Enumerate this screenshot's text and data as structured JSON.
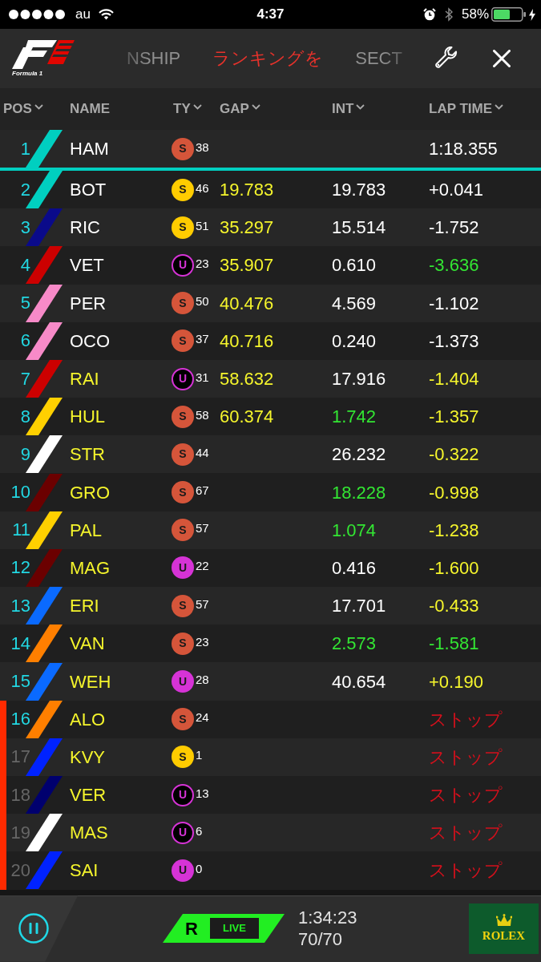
{
  "status_bar": {
    "carrier": "au",
    "time": "4:37",
    "battery": "58%"
  },
  "header": {
    "logo_caption": "Formula 1",
    "tabs": [
      {
        "label": "NSHIP",
        "selected": false
      },
      {
        "label": "ランキングを",
        "selected": true
      },
      {
        "label": "SECT",
        "selected": false
      }
    ]
  },
  "columns": [
    {
      "label": "POS",
      "sortable": true
    },
    {
      "label": "NAME",
      "sortable": false
    },
    {
      "label": "TY",
      "sortable": true
    },
    {
      "label": "GAP",
      "sortable": true
    },
    {
      "label": "INT",
      "sortable": true
    },
    {
      "label": "LAP TIME",
      "sortable": true
    }
  ],
  "rows": [
    {
      "pos": {
        "text": "1",
        "color": "#22d7e2"
      },
      "stripe": {
        "color": "#00cfc0"
      },
      "name": {
        "text": "HAM",
        "color": "#ffffff"
      },
      "tyre": {
        "compound": "S",
        "color": "#d5553a",
        "outline": false,
        "laps": "38"
      },
      "lap_time": {
        "text": "1:18.355",
        "color": "#ffffff"
      },
      "retired": false
    },
    {
      "pos": {
        "text": "2",
        "color": "#22d7e2"
      },
      "stripe": {
        "color": "#00cfc0"
      },
      "name": {
        "text": "BOT",
        "color": "#ffffff"
      },
      "tyre": {
        "compound": "S",
        "color": "#ffcc00",
        "outline": false,
        "laps": "46"
      },
      "gap": {
        "text": "19.783",
        "color": "#f5f52c"
      },
      "interval": {
        "text": "19.783",
        "color": "#ffffff"
      },
      "lap_time": {
        "text": "+0.041",
        "color": "#ffffff"
      },
      "retired": false
    },
    {
      "pos": {
        "text": "3",
        "color": "#22d7e2"
      },
      "stripe": {
        "color": "#0a0a8a"
      },
      "name": {
        "text": "RIC",
        "color": "#ffffff"
      },
      "tyre": {
        "compound": "S",
        "color": "#ffcc00",
        "outline": false,
        "laps": "51"
      },
      "gap": {
        "text": "35.297",
        "color": "#f5f52c"
      },
      "interval": {
        "text": "15.514",
        "color": "#ffffff"
      },
      "lap_time": {
        "text": "-1.752",
        "color": "#ffffff"
      },
      "retired": false
    },
    {
      "pos": {
        "text": "4",
        "color": "#22d7e2"
      },
      "stripe": {
        "color": "#cc0000"
      },
      "name": {
        "text": "VET",
        "color": "#ffffff"
      },
      "tyre": {
        "compound": "U",
        "color": "#d633d6",
        "outline": true,
        "laps": "23"
      },
      "gap": {
        "text": "35.907",
        "color": "#f5f52c"
      },
      "interval": {
        "text": "0.610",
        "color": "#ffffff"
      },
      "lap_time": {
        "text": "-3.636",
        "color": "#33e633"
      },
      "retired": false
    },
    {
      "pos": {
        "text": "5",
        "color": "#22d7e2"
      },
      "stripe": {
        "color": "#f78ac8"
      },
      "name": {
        "text": "PER",
        "color": "#ffffff"
      },
      "tyre": {
        "compound": "S",
        "color": "#d5553a",
        "outline": false,
        "laps": "50"
      },
      "gap": {
        "text": "40.476",
        "color": "#f5f52c"
      },
      "interval": {
        "text": "4.569",
        "color": "#ffffff"
      },
      "lap_time": {
        "text": "-1.102",
        "color": "#ffffff"
      },
      "retired": false
    },
    {
      "pos": {
        "text": "6",
        "color": "#22d7e2"
      },
      "stripe": {
        "color": "#f78ac8"
      },
      "name": {
        "text": "OCO",
        "color": "#ffffff"
      },
      "tyre": {
        "compound": "S",
        "color": "#d5553a",
        "outline": false,
        "laps": "37"
      },
      "gap": {
        "text": "40.716",
        "color": "#f5f52c"
      },
      "interval": {
        "text": "0.240",
        "color": "#ffffff"
      },
      "lap_time": {
        "text": "-1.373",
        "color": "#ffffff"
      },
      "retired": false
    },
    {
      "pos": {
        "text": "7",
        "color": "#22d7e2"
      },
      "stripe": {
        "color": "#cc0000"
      },
      "name": {
        "text": "RAI",
        "color": "#f5f52c"
      },
      "tyre": {
        "compound": "U",
        "color": "#d633d6",
        "outline": true,
        "laps": "31"
      },
      "gap": {
        "text": "58.632",
        "color": "#f5f52c"
      },
      "interval": {
        "text": "17.916",
        "color": "#ffffff"
      },
      "lap_time": {
        "text": "-1.404",
        "color": "#f5f52c"
      },
      "retired": false
    },
    {
      "pos": {
        "text": "8",
        "color": "#22d7e2"
      },
      "stripe": {
        "color": "#ffd000"
      },
      "name": {
        "text": "HUL",
        "color": "#f5f52c"
      },
      "tyre": {
        "compound": "S",
        "color": "#d5553a",
        "outline": false,
        "laps": "58"
      },
      "gap": {
        "text": "60.374",
        "color": "#f5f52c"
      },
      "interval": {
        "text": "1.742",
        "color": "#33e633"
      },
      "lap_time": {
        "text": "-1.357",
        "color": "#f5f52c"
      },
      "retired": false
    },
    {
      "pos": {
        "text": "9",
        "color": "#22d7e2"
      },
      "stripe": {
        "color": "#ffffff"
      },
      "name": {
        "text": "STR",
        "color": "#f5f52c"
      },
      "tyre": {
        "compound": "S",
        "color": "#d5553a",
        "outline": false,
        "laps": "44"
      },
      "interval": {
        "text": "26.232",
        "color": "#ffffff"
      },
      "lap_time": {
        "text": "-0.322",
        "color": "#f5f52c"
      },
      "retired": false
    },
    {
      "pos": {
        "text": "10",
        "color": "#22d7e2"
      },
      "stripe": {
        "color": "#6b0000"
      },
      "name": {
        "text": "GRO",
        "color": "#f5f52c"
      },
      "tyre": {
        "compound": "S",
        "color": "#d5553a",
        "outline": false,
        "laps": "67"
      },
      "interval": {
        "text": "18.228",
        "color": "#33e633"
      },
      "lap_time": {
        "text": "-0.998",
        "color": "#f5f52c"
      },
      "retired": false
    },
    {
      "pos": {
        "text": "11",
        "color": "#22d7e2"
      },
      "stripe": {
        "color": "#ffd000"
      },
      "name": {
        "text": "PAL",
        "color": "#f5f52c"
      },
      "tyre": {
        "compound": "S",
        "color": "#d5553a",
        "outline": false,
        "laps": "57"
      },
      "interval": {
        "text": "1.074",
        "color": "#33e633"
      },
      "lap_time": {
        "text": "-1.238",
        "color": "#f5f52c"
      },
      "retired": false
    },
    {
      "pos": {
        "text": "12",
        "color": "#22d7e2"
      },
      "stripe": {
        "color": "#6b0000"
      },
      "name": {
        "text": "MAG",
        "color": "#f5f52c"
      },
      "tyre": {
        "compound": "U",
        "color": "#d633d6",
        "outline": false,
        "laps": "22"
      },
      "interval": {
        "text": "0.416",
        "color": "#ffffff"
      },
      "lap_time": {
        "text": "-1.600",
        "color": "#f5f52c"
      },
      "retired": false
    },
    {
      "pos": {
        "text": "13",
        "color": "#22d7e2"
      },
      "stripe": {
        "color": "#0a6aff"
      },
      "name": {
        "text": "ERI",
        "color": "#f5f52c"
      },
      "tyre": {
        "compound": "S",
        "color": "#d5553a",
        "outline": false,
        "laps": "57"
      },
      "interval": {
        "text": "17.701",
        "color": "#ffffff"
      },
      "lap_time": {
        "text": "-0.433",
        "color": "#f5f52c"
      },
      "retired": false
    },
    {
      "pos": {
        "text": "14",
        "color": "#22d7e2"
      },
      "stripe": {
        "color": "#ff7f00"
      },
      "name": {
        "text": "VAN",
        "color": "#f5f52c"
      },
      "tyre": {
        "compound": "S",
        "color": "#d5553a",
        "outline": false,
        "laps": "23"
      },
      "interval": {
        "text": "2.573",
        "color": "#33e633"
      },
      "lap_time": {
        "text": "-1.581",
        "color": "#33e633"
      },
      "retired": false
    },
    {
      "pos": {
        "text": "15",
        "color": "#22d7e2"
      },
      "stripe": {
        "color": "#0a6aff"
      },
      "name": {
        "text": "WEH",
        "color": "#f5f52c"
      },
      "tyre": {
        "compound": "U",
        "color": "#d633d6",
        "outline": false,
        "laps": "28"
      },
      "interval": {
        "text": "40.654",
        "color": "#ffffff"
      },
      "lap_time": {
        "text": "+0.190",
        "color": "#f5f52c"
      },
      "retired": false
    },
    {
      "pos": {
        "text": "16",
        "color": "#22d7e2"
      },
      "stripe": {
        "color": "#ff7f00"
      },
      "name": {
        "text": "ALO",
        "color": "#f5f52c"
      },
      "tyre": {
        "compound": "S",
        "color": "#d5553a",
        "outline": false,
        "laps": "24"
      },
      "lap_time": {
        "text": "ストップ",
        "color": "#d4101c"
      },
      "retired": true
    },
    {
      "pos": {
        "text": "17",
        "color": "#666666"
      },
      "stripe": {
        "color": "#0022ff"
      },
      "name": {
        "text": "KVY",
        "color": "#f5f52c"
      },
      "tyre": {
        "compound": "S",
        "color": "#ffcc00",
        "outline": false,
        "laps": "1"
      },
      "lap_time": {
        "text": "ストップ",
        "color": "#d4101c"
      },
      "retired": true
    },
    {
      "pos": {
        "text": "18",
        "color": "#666666"
      },
      "stripe": {
        "color": "#00006e"
      },
      "name": {
        "text": "VER",
        "color": "#f5f52c"
      },
      "tyre": {
        "compound": "U",
        "color": "#d633d6",
        "outline": true,
        "laps": "13"
      },
      "lap_time": {
        "text": "ストップ",
        "color": "#d4101c"
      },
      "retired": true
    },
    {
      "pos": {
        "text": "19",
        "color": "#666666"
      },
      "stripe": {
        "color": "#ffffff"
      },
      "name": {
        "text": "MAS",
        "color": "#f5f52c"
      },
      "tyre": {
        "compound": "U",
        "color": "#d633d6",
        "outline": true,
        "laps": "6"
      },
      "lap_time": {
        "text": "ストップ",
        "color": "#d4101c"
      },
      "retired": true
    },
    {
      "pos": {
        "text": "20",
        "color": "#666666"
      },
      "stripe": {
        "color": "#0022ff"
      },
      "name": {
        "text": "SAI",
        "color": "#f5f52c"
      },
      "tyre": {
        "compound": "U",
        "color": "#d633d6",
        "outline": false,
        "laps": "0"
      },
      "lap_time": {
        "text": "ストップ",
        "color": "#d4101c"
      },
      "retired": true
    }
  ],
  "footer": {
    "session": "R",
    "live": "LIVE",
    "elapsed": "1:34:23",
    "laps": "70/70",
    "sponsor": "ROLEX"
  }
}
